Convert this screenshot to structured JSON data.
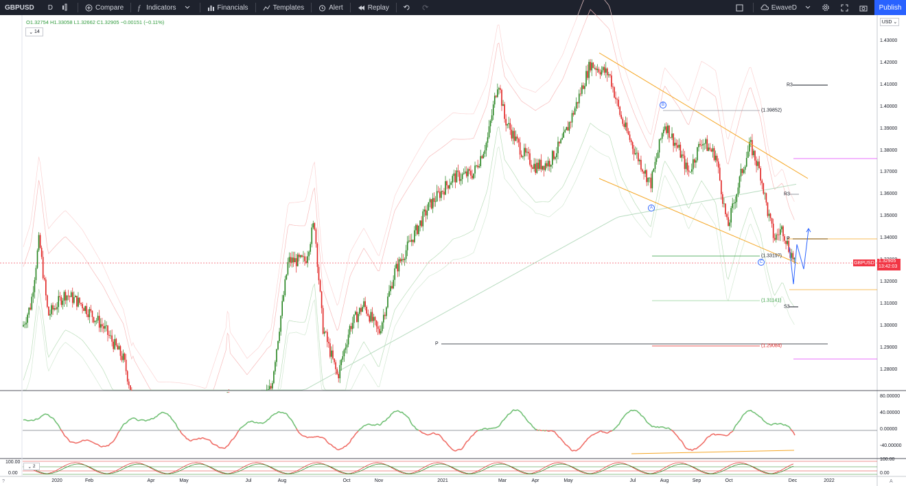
{
  "toolbar": {
    "symbol": "GBPUSD",
    "interval": "D",
    "compare": "Compare",
    "indicators": "Indicators",
    "financials": "Financials",
    "templates": "Templates",
    "alert": "Alert",
    "replay": "Replay",
    "layout_name": "EwaveD",
    "publish": "Publish"
  },
  "legend": {
    "ohlc": "O1.32754  H1.33058  L1.32662  C1.32905  −0.00151  (−0.11%)",
    "collapse": "14",
    "indicator_collapse": "2"
  },
  "price_axis": {
    "currency": "USD",
    "ticks": [
      "1.43000",
      "1.42000",
      "1.41000",
      "1.40000",
      "1.39000",
      "1.38000",
      "1.37000",
      "1.36000",
      "1.35000",
      "1.34000",
      "1.33000",
      "1.32000",
      "1.31000",
      "1.30000",
      "1.29000",
      "1.28000"
    ],
    "symbol_tag": "GBPUSD",
    "last_price": "1.32905",
    "countdown": "13:42:03"
  },
  "oscillator_axis": {
    "ticks": [
      "80.00000",
      "40.00000",
      "0.00000",
      "-40.00000"
    ]
  },
  "stoch_axis": {
    "ticks": [
      "100.00",
      "0.00"
    ],
    "right_ticks": [
      "100.00",
      "0.00"
    ]
  },
  "time_axis": {
    "labels": [
      "2020",
      "Feb",
      "Apr",
      "May",
      "Jul",
      "Aug",
      "Oct",
      "Nov",
      "2021",
      "Mar",
      "Apr",
      "May",
      "Jul",
      "Aug",
      "Sep",
      "Oct",
      "Dec",
      "2022"
    ]
  },
  "levels": {
    "r3_top": "R3",
    "r3_mid": "R3",
    "p_right": "P",
    "s3": "S3",
    "p_left": "P",
    "fib_1": "(1.39852)",
    "fib_2": "(1.33197)",
    "fib_3": "(1.31141)",
    "fib_4": "(1.29084)"
  },
  "waves": {
    "a": "A",
    "b": "B",
    "c": "C"
  },
  "colors": {
    "up": "#22821c",
    "down": "#e0201f",
    "accent": "#2962ff",
    "toolbar_bg": "#1e222d",
    "trendline": "#f5a623",
    "oscillator_up": "#6fbf73",
    "oscillator_down": "#ef6b64"
  }
}
